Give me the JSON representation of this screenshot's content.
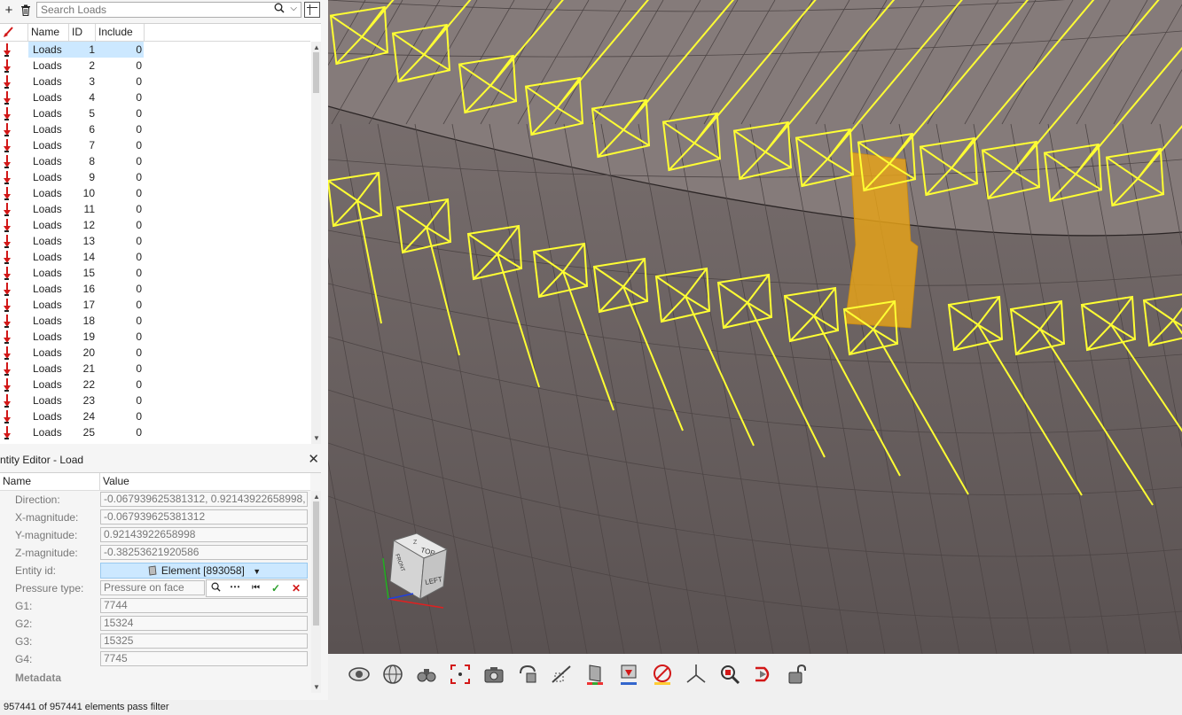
{
  "toolbar": {
    "search_placeholder": "Search Loads"
  },
  "list": {
    "columns": [
      "Name",
      "ID",
      "Include"
    ],
    "rows": [
      {
        "name": "Loads",
        "id": "1",
        "include": "0"
      },
      {
        "name": "Loads",
        "id": "2",
        "include": "0"
      },
      {
        "name": "Loads",
        "id": "3",
        "include": "0"
      },
      {
        "name": "Loads",
        "id": "4",
        "include": "0"
      },
      {
        "name": "Loads",
        "id": "5",
        "include": "0"
      },
      {
        "name": "Loads",
        "id": "6",
        "include": "0"
      },
      {
        "name": "Loads",
        "id": "7",
        "include": "0"
      },
      {
        "name": "Loads",
        "id": "8",
        "include": "0"
      },
      {
        "name": "Loads",
        "id": "9",
        "include": "0"
      },
      {
        "name": "Loads",
        "id": "10",
        "include": "0"
      },
      {
        "name": "Loads",
        "id": "11",
        "include": "0"
      },
      {
        "name": "Loads",
        "id": "12",
        "include": "0"
      },
      {
        "name": "Loads",
        "id": "13",
        "include": "0"
      },
      {
        "name": "Loads",
        "id": "14",
        "include": "0"
      },
      {
        "name": "Loads",
        "id": "15",
        "include": "0"
      },
      {
        "name": "Loads",
        "id": "16",
        "include": "0"
      },
      {
        "name": "Loads",
        "id": "17",
        "include": "0"
      },
      {
        "name": "Loads",
        "id": "18",
        "include": "0"
      },
      {
        "name": "Loads",
        "id": "19",
        "include": "0"
      },
      {
        "name": "Loads",
        "id": "20",
        "include": "0"
      },
      {
        "name": "Loads",
        "id": "21",
        "include": "0"
      },
      {
        "name": "Loads",
        "id": "22",
        "include": "0"
      },
      {
        "name": "Loads",
        "id": "23",
        "include": "0"
      },
      {
        "name": "Loads",
        "id": "24",
        "include": "0"
      },
      {
        "name": "Loads",
        "id": "25",
        "include": "0"
      }
    ]
  },
  "entity_editor": {
    "title": "ntity Editor - Load",
    "col_name": "Name",
    "col_value": "Value",
    "direction_label": "Direction:",
    "direction_value": "-0.067939625381312, 0.92143922658998, -...",
    "xmag_label": "X-magnitude:",
    "xmag_value": "-0.067939625381312",
    "ymag_label": "Y-magnitude:",
    "ymag_value": "0.92143922658998",
    "zmag_label": "Z-magnitude:",
    "zmag_value": "-0.38253621920586",
    "entity_label": "Entity id:",
    "entity_value": "Element [893058]",
    "pressure_label": "Pressure type:",
    "pressure_value": "Pressure on face",
    "g1_label": "G1:",
    "g1_value": "7744",
    "g2_label": "G2:",
    "g2_value": "15324",
    "g3_label": "G3:",
    "g3_value": "15325",
    "g4_label": "G4:",
    "g4_value": "7745",
    "metadata_label": "Metadata"
  },
  "viewcube": {
    "top": "TOP",
    "left": "LEFT",
    "front": "FRONT",
    "z": "Z"
  },
  "status": {
    "text": "957441 of 957441 elements pass filter"
  },
  "colors": {
    "selection": "#cce8ff",
    "load_glyph": "#ffff33",
    "highlight": "#e8a317",
    "mesh": "#7a7070"
  }
}
